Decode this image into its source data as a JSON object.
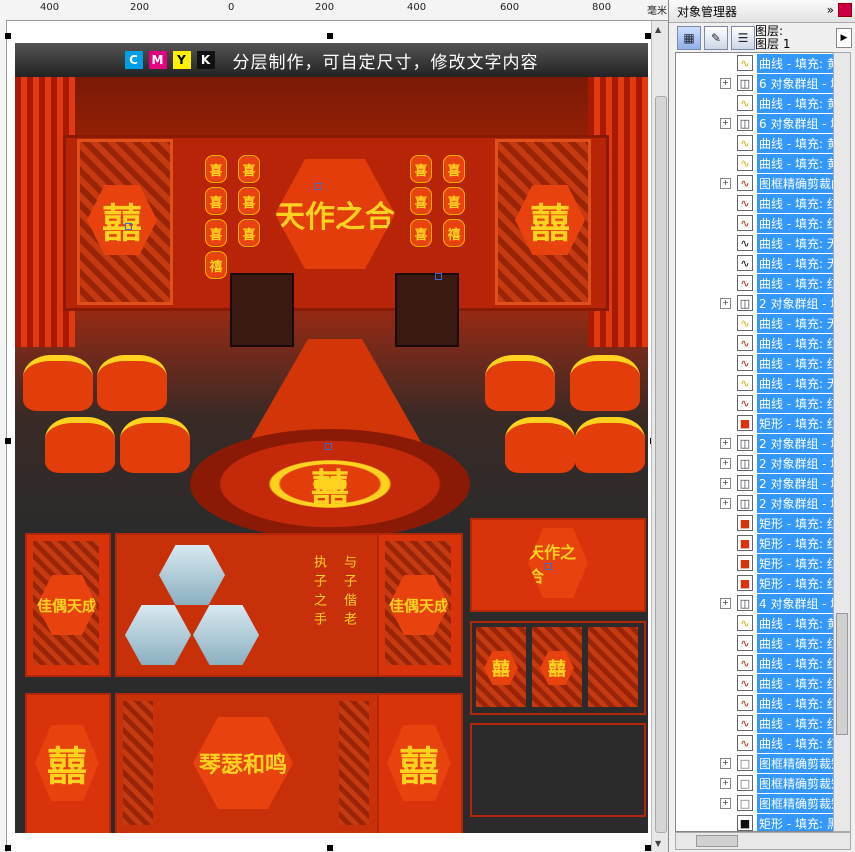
{
  "ruler": {
    "labels": [
      "400",
      "200",
      "0",
      "200",
      "400",
      "600",
      "800"
    ],
    "unit": "毫米"
  },
  "banner": {
    "c": "C",
    "m": "M",
    "y": "Y",
    "k": "K",
    "text": "分层制作，可自定尺寸，修改文字内容"
  },
  "artwork": {
    "xi": "囍",
    "center_title": "天作之合",
    "lantern_left_a": [
      "喜",
      "喜",
      "喜",
      "禧"
    ],
    "lantern_left_b": [
      "喜",
      "喜",
      "喜"
    ],
    "lantern_right_a": [
      "喜",
      "喜",
      "喜"
    ],
    "lantern_right_b": [
      "喜",
      "喜",
      "禧"
    ],
    "poem_a": "执子之手",
    "poem_b": "与子偕老",
    "panel_qinse": "琴瑟和鸣",
    "panel_zuohe": "佳偶天成"
  },
  "object_manager": {
    "title": "对象管理器",
    "layer_line1": "图层:",
    "layer_line2": "图层 1",
    "items": [
      {
        "expand": "",
        "icon": "curve-yellow",
        "label": "曲线 - 填充: 黄"
      },
      {
        "expand": "+",
        "icon": "group",
        "label": "6 对象群组 - 填"
      },
      {
        "expand": "",
        "icon": "curve-yellow",
        "label": "曲线 - 填充: 黄"
      },
      {
        "expand": "+",
        "icon": "group",
        "label": "6 对象群组 - 填"
      },
      {
        "expand": "",
        "icon": "curve-yellow",
        "label": "曲线 - 填充: 黄"
      },
      {
        "expand": "",
        "icon": "curve-yellow",
        "label": "曲线 - 填充: 黄"
      },
      {
        "expand": "+",
        "icon": "curve-red",
        "label": "图框精确剪裁曲"
      },
      {
        "expand": "",
        "icon": "curve-red",
        "label": "曲线 - 填充: 红"
      },
      {
        "expand": "",
        "icon": "curve-red",
        "label": "曲线 - 填充: 红"
      },
      {
        "expand": "",
        "icon": "curve-black",
        "label": "曲线 - 填充: 无"
      },
      {
        "expand": "",
        "icon": "curve-black",
        "label": "曲线 - 填充: 无"
      },
      {
        "expand": "",
        "icon": "curve-red",
        "label": "曲线 - 填充: 红"
      },
      {
        "expand": "+",
        "icon": "group",
        "label": "2 对象群组 - 填"
      },
      {
        "expand": "",
        "icon": "curve-yellow",
        "label": "曲线 - 填充: 无"
      },
      {
        "expand": "",
        "icon": "curve-red",
        "label": "曲线 - 填充: 红"
      },
      {
        "expand": "",
        "icon": "curve-red",
        "label": "曲线 - 填充: 红"
      },
      {
        "expand": "",
        "icon": "curve-yellow",
        "label": "曲线 - 填充: 无"
      },
      {
        "expand": "",
        "icon": "curve-red",
        "label": "曲线 - 填充: 红"
      },
      {
        "expand": "",
        "icon": "rect-red",
        "label": "矩形 - 填充: 红"
      },
      {
        "expand": "+",
        "icon": "group",
        "label": "2 对象群组 - 填"
      },
      {
        "expand": "+",
        "icon": "group",
        "label": "2 对象群组 - 填"
      },
      {
        "expand": "+",
        "icon": "group",
        "label": "2 对象群组 - 填"
      },
      {
        "expand": "+",
        "icon": "group",
        "label": "2 对象群组 - 填"
      },
      {
        "expand": "",
        "icon": "rect-red",
        "label": "矩形 - 填充: 红"
      },
      {
        "expand": "",
        "icon": "rect-red",
        "label": "矩形 - 填充: 红"
      },
      {
        "expand": "",
        "icon": "rect-red",
        "label": "矩形 - 填充: 红"
      },
      {
        "expand": "",
        "icon": "rect-red",
        "label": "矩形 - 填充: 红"
      },
      {
        "expand": "+",
        "icon": "group",
        "label": "4 对象群组 - 填"
      },
      {
        "expand": "",
        "icon": "curve-yellow",
        "label": "曲线 - 填充: 黄"
      },
      {
        "expand": "",
        "icon": "curve-red",
        "label": "曲线 - 填充: 红"
      },
      {
        "expand": "",
        "icon": "curve-red",
        "label": "曲线 - 填充: 红"
      },
      {
        "expand": "",
        "icon": "curve-red",
        "label": "曲线 - 填充: 红"
      },
      {
        "expand": "",
        "icon": "curve-red",
        "label": "曲线 - 填充: 红"
      },
      {
        "expand": "",
        "icon": "curve-red",
        "label": "曲线 - 填充: 红"
      },
      {
        "expand": "",
        "icon": "curve-red",
        "label": "曲线 - 填充: 红"
      },
      {
        "expand": "+",
        "icon": "rect-white",
        "label": "图框精确剪裁矩"
      },
      {
        "expand": "+",
        "icon": "rect-white",
        "label": "图框精确剪裁矩"
      },
      {
        "expand": "+",
        "icon": "rect-white",
        "label": "图框精确剪裁矩"
      },
      {
        "expand": "",
        "icon": "rect-black",
        "label": "矩形 - 填充: 黑"
      }
    ]
  },
  "colors": {
    "selection": "#3399ff",
    "wedding_red": "#e33d0b",
    "gold": "#ffd21f"
  }
}
